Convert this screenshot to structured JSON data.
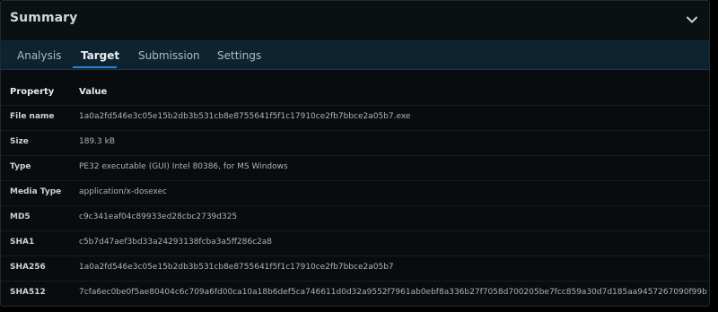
{
  "header": {
    "title": "Summary"
  },
  "tabs": [
    {
      "label": "Analysis"
    },
    {
      "label": "Target"
    },
    {
      "label": "Submission"
    },
    {
      "label": "Settings"
    }
  ],
  "active_tab": "Target",
  "table": {
    "headers": {
      "property": "Property",
      "value": "Value"
    },
    "rows": [
      {
        "property": "File name",
        "value": "1a0a2fd546e3c05e15b2db3b531cb8e8755641f5f1c17910ce2fb7bbce2a05b7.exe"
      },
      {
        "property": "Size",
        "value": "189.3 kB"
      },
      {
        "property": "Type",
        "value": "PE32 executable (GUI) Intel 80386, for MS Windows"
      },
      {
        "property": "Media Type",
        "value": "application/x-dosexec"
      },
      {
        "property": "MD5",
        "value": "c9c341eaf04c89933ed28cbc2739d325"
      },
      {
        "property": "SHA1",
        "value": "c5b7d47aef3bd33a24293138fcba3a5ff286c2a8"
      },
      {
        "property": "SHA256",
        "value": "1a0a2fd546e3c05e15b2db3b531cb8e8755641f5f1c17910ce2fb7bbce2a05b7"
      },
      {
        "property": "SHA512",
        "value": "7cfa6ec0be0f5ae80404c6c709a6fd00ca10a18b6def5ca746611d0d32a9552f7961ab0ebf8a336b27f7058d700205be7fcc859a30d7d185aa9457267090f99b"
      }
    ]
  },
  "colors": {
    "accent": "#2f7fd0",
    "tab_bar": "#0e2330",
    "panel_bg": "#080c0e"
  }
}
